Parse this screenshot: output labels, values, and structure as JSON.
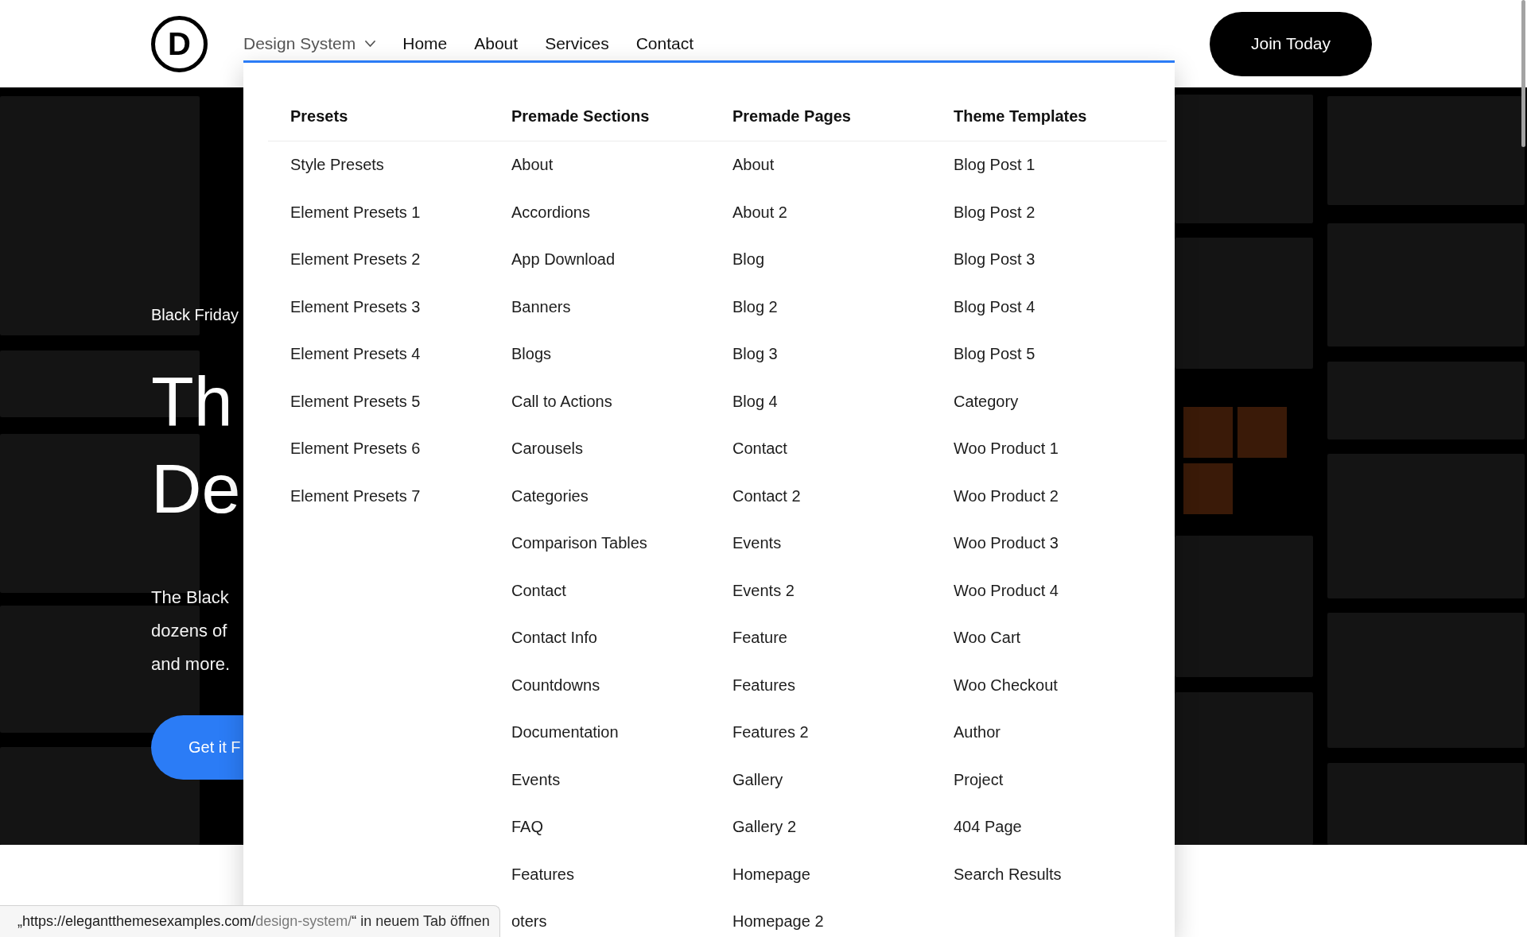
{
  "header": {
    "logo": "D",
    "nav": [
      {
        "label": "Design System",
        "kind": "dropdown",
        "expanded": true,
        "menu": {
          "columns": [
            {
              "heading": "Presets",
              "items": [
                "Style Presets",
                "Element Presets 1",
                "Element Presets 2",
                "Element Presets 3",
                "Element Presets 4",
                "Element Presets 5",
                "Element Presets 6",
                "Element Presets 7"
              ]
            },
            {
              "heading": "Premade Sections",
              "items": [
                "About",
                "Accordions",
                "App Download",
                "Banners",
                "Blogs",
                "Call to Actions",
                "Carousels",
                "Categories",
                "Comparison Tables",
                "Contact",
                "Contact Info",
                "Countdowns",
                "Documentation",
                "Events",
                "FAQ",
                "Features",
                "oters"
              ]
            },
            {
              "heading": "Premade Pages",
              "items": [
                "About",
                "About 2",
                "Blog",
                "Blog 2",
                "Blog 3",
                "Blog 4",
                "Contact",
                "Contact 2",
                "Events",
                "Events 2",
                "Feature",
                "Features",
                "Features 2",
                "Gallery",
                "Gallery 2",
                "Homepage",
                "Homepage 2"
              ]
            },
            {
              "heading": "Theme Templates",
              "items": [
                "Blog Post 1",
                "Blog Post 2",
                "Blog Post 3",
                "Blog Post 4",
                "Blog Post 5",
                "Category",
                "Woo Product 1",
                "Woo Product 2",
                "Woo Product 3",
                "Woo Product 4",
                "Woo Cart",
                "Woo Checkout",
                "Author",
                "Project",
                "404 Page",
                "Search Results"
              ]
            }
          ]
        }
      },
      {
        "label": "Home",
        "kind": "link",
        "expanded": false
      },
      {
        "label": "About",
        "kind": "link",
        "expanded": false
      },
      {
        "label": "Services",
        "kind": "link",
        "expanded": false
      },
      {
        "label": "Contact",
        "kind": "link",
        "expanded": false
      }
    ],
    "cta": "Join Today"
  },
  "hero": {
    "eyebrow": "Black Friday",
    "title_lines": [
      "Th",
      "De"
    ],
    "description_lines": [
      "The Black",
      "dozens of",
      "and more."
    ],
    "button": "Get it F"
  },
  "link_tooltip": {
    "parts": [
      {
        "text": "„https://elegantthemesexamples.com/",
        "kind": "host"
      },
      {
        "text": "design-system/",
        "kind": "path"
      },
      {
        "text": "“ in neuem Tab öffnen",
        "kind": "plain"
      }
    ]
  }
}
